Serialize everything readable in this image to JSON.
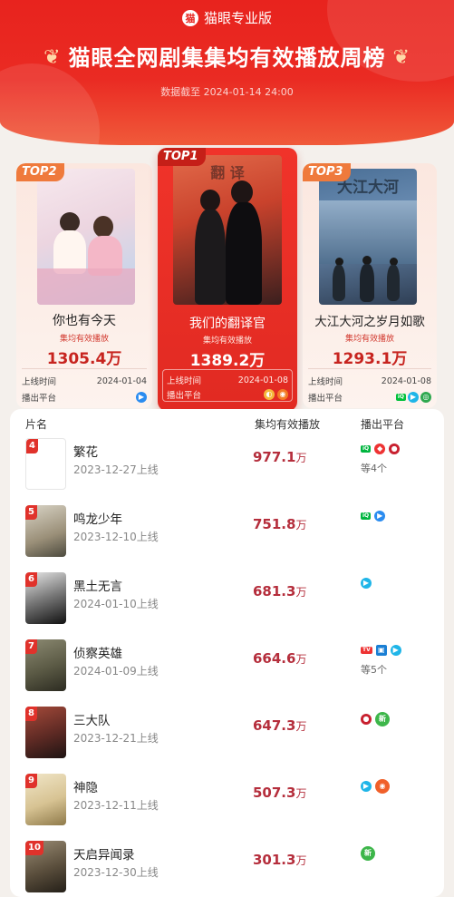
{
  "brand": {
    "logo_glyph": "猫",
    "name": "猫眼专业版"
  },
  "header": {
    "title": "猫眼全网剧集集均有效播放周榜",
    "wing_glyph": "❦",
    "date": "数据截至 2024-01-14 24:00"
  },
  "labels": {
    "metric": "集均有效播放",
    "launch": "上线时间",
    "platform": "播出平台",
    "wan": "万"
  },
  "top3": [
    {
      "badge": "TOP2",
      "name": "你也有今天",
      "value": "1305.4",
      "date": "2024-01-04",
      "platforms": [
        "youku"
      ]
    },
    {
      "badge": "TOP1",
      "name": "我们的翻译官",
      "value": "1389.2",
      "date": "2024-01-08",
      "platforms": [
        "mango",
        "youku-orange"
      ]
    },
    {
      "badge": "TOP3",
      "name": "大江大河之岁月如歌",
      "value": "1293.1",
      "date": "2024-01-08",
      "platforms": [
        "iqiyi",
        "tencent",
        "mgtv"
      ]
    }
  ],
  "list": {
    "headers": {
      "name": "片名",
      "metric": "集均有效播放",
      "platform": "播出平台"
    },
    "rows": [
      {
        "rank": "4",
        "name": "繁花",
        "date": "2023-12-27上线",
        "value": "977.1",
        "unit": "万",
        "more": "等4个"
      },
      {
        "rank": "5",
        "name": "鸣龙少年",
        "date": "2023-12-10上线",
        "value": "751.8",
        "unit": "万",
        "more": ""
      },
      {
        "rank": "6",
        "name": "黑土无言",
        "date": "2024-01-10上线",
        "value": "681.3",
        "unit": "万",
        "more": ""
      },
      {
        "rank": "7",
        "name": "侦察英雄",
        "date": "2024-01-09上线",
        "value": "664.6",
        "unit": "万",
        "more": "等5个"
      },
      {
        "rank": "8",
        "name": "三大队",
        "date": "2023-12-21上线",
        "value": "647.3",
        "unit": "万",
        "more": ""
      },
      {
        "rank": "9",
        "name": "神隐",
        "date": "2023-12-11上线",
        "value": "507.3",
        "unit": "万",
        "more": ""
      },
      {
        "rank": "10",
        "name": "天启异闻录",
        "date": "2023-12-30上线",
        "value": "301.3",
        "unit": "万",
        "more": ""
      }
    ]
  },
  "colors": {
    "accent": "#e8231e",
    "value": "#b52e3c",
    "badge_orange": "#ef7a3c"
  }
}
